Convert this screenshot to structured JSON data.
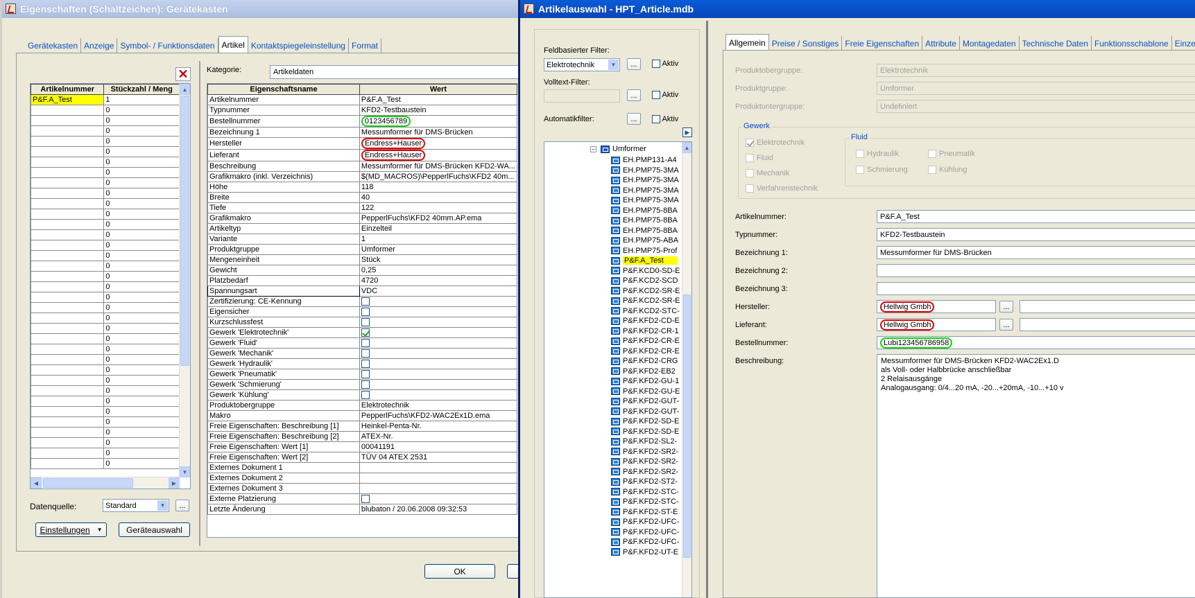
{
  "win1": {
    "title": "Eigenschaften (Schaltzeichen): Gerätekasten",
    "tabs": [
      "Gerätekasten",
      "Anzeige",
      "Symbol- / Funktionsdaten",
      "Artikel",
      "Kontaktspiegeleinstellung",
      "Format"
    ],
    "left_table": {
      "headers": [
        "Artikelnummer",
        "Stückzahl / Meng"
      ],
      "first_row": [
        "P&F.A_Test",
        "1"
      ],
      "zero": "0",
      "last_zero": "0"
    },
    "kategorie_label": "Kategorie:",
    "kategorie_value": "Artikeldaten",
    "prop_headers": [
      "Eigenschaftsname",
      "Wert"
    ],
    "props": [
      [
        "Artikelnummer",
        "P&F.A_Test"
      ],
      [
        "Typnummer",
        "KFD2-Testbaustein"
      ],
      [
        "Bestellnummer",
        "0123456789"
      ],
      [
        "Bezeichnung 1",
        "Messumformer für DMS-Brücken"
      ],
      [
        "Hersteller",
        "Endress+Hauser"
      ],
      [
        "Lieferant",
        "Endress+Hauser"
      ],
      [
        "Beschreibung",
        "Messumformer für DMS-Brücken KFD2-WA..."
      ],
      [
        "Grafikmakro (inkl. Verzeichnis)",
        "$(MD_MACROS)\\PepperlFuchs\\KFD2 40m..."
      ],
      [
        "Höhe",
        "118"
      ],
      [
        "Breite",
        "40"
      ],
      [
        "Tiefe",
        "122"
      ],
      [
        "Grafikmakro",
        "PepperlFuchs\\KFD2 40mm.AP.ema"
      ],
      [
        "Artikeltyp",
        "Einzelteil"
      ],
      [
        "Variante",
        "1"
      ],
      [
        "Produktgruppe",
        "Umformer"
      ],
      [
        "Mengeneinheit",
        "Stück"
      ],
      [
        "Gewicht",
        "0,25"
      ],
      [
        "Platzbedarf",
        "4720"
      ],
      [
        "Spannungsart",
        "VDC"
      ],
      [
        "Zertifizierung: CE-Kennung",
        ""
      ],
      [
        "Eigensicher",
        ""
      ],
      [
        "Kurzschlussfest",
        ""
      ],
      [
        "Gewerk 'Elektrotechnik'",
        ""
      ],
      [
        "Gewerk 'Fluid'",
        ""
      ],
      [
        "Gewerk 'Mechanik'",
        ""
      ],
      [
        "Gewerk 'Hydraulik'",
        ""
      ],
      [
        "Gewerk 'Pneumatik'",
        ""
      ],
      [
        "Gewerk 'Schmierung'",
        ""
      ],
      [
        "Gewerk 'Kühlung'",
        ""
      ],
      [
        "Produktobergruppe",
        "Elektrotechnik"
      ],
      [
        "Makro",
        "PepperlFuchs\\KFD2-WAC2Ex1D.ema"
      ],
      [
        "Freie Eigenschaften: Beschreibung [1]",
        "Heinkel-Penta-Nr."
      ],
      [
        "Freie Eigenschaften: Beschreibung [2]",
        "ATEX-Nr."
      ],
      [
        "Freie Eigenschaften: Wert [1]",
        "00041191"
      ],
      [
        "Freie Eigenschaften: Wert [2]",
        "TÜV 04 ATEX 2531"
      ],
      [
        "Externes Dokument 1",
        ""
      ],
      [
        "Externes Dokument 2",
        ""
      ],
      [
        "Externes Dokument 3",
        ""
      ],
      [
        "Externe Platzierung",
        ""
      ],
      [
        "Letzte Änderung",
        "blubaton / 20.06.2008 09:32:53"
      ]
    ],
    "datenquelle_label": "Datenquelle:",
    "datenquelle_value": "Standard",
    "btn_einstellungen": "Einstellungen",
    "btn_geraeteauswahl": "Geräteauswahl",
    "btn_ok": "OK",
    "dots": "..."
  },
  "win2": {
    "title": "Artikelauswahl - HPT_Article.mdb",
    "feld_filter_label": "Feldbasierter Filter:",
    "feld_filter_value": "Elektrotechnik",
    "volltext_label": "Volltext-Filter:",
    "automatik_label": "Automatikfilter:",
    "aktiv": "Aktiv",
    "dots": "...",
    "tree_root": "Umformer",
    "tree_items": [
      "EH.PMP131-A4",
      "EH.PMP75-3MA",
      "EH.PMP75-3MA",
      "EH.PMP75-3MA",
      "EH.PMP75-3MA",
      "EH.PMP75-8BA",
      "EH.PMP75-8BA",
      "EH.PMP75-8BA",
      "EH.PMP75-ABA",
      "EH.PMP75-Prof",
      "P&F.A_Test",
      "P&F.KCD0-SD-E",
      "P&F.KCD2-SCD",
      "P&F.KCD2-SR-E",
      "P&F.KCD2-SR-E",
      "P&F.KCD2-STC-",
      "P&F.KFD2-CD-E",
      "P&F.KFD2-CR-1",
      "P&F.KFD2-CR-E",
      "P&F.KFD2-CR-E",
      "P&F.KFD2-CRG",
      "P&F.KFD2-EB2",
      "P&F.KFD2-GU-1",
      "P&F.KFD2-GU-E",
      "P&F.KFD2-GUT-",
      "P&F.KFD2-GUT-",
      "P&F.KFD2-SD-E",
      "P&F.KFD2-SD-E",
      "P&F.KFD2-SL2-",
      "P&F.KFD2-SR2-",
      "P&F.KFD2-SR2-",
      "P&F.KFD2-SR2-",
      "P&F.KFD2-ST2-",
      "P&F.KFD2-STC-",
      "P&F.KFD2-STC-",
      "P&F.KFD2-ST-E",
      "P&F.KFD2-UFC-",
      "P&F.KFD2-UFC-",
      "P&F.KFD2-UFC-",
      "P&F.KFD2-UT-E"
    ],
    "tabs": [
      "Allgemein",
      "Preise / Sonstiges",
      "Freie Eigenschaften",
      "Attribute",
      "Montagedaten",
      "Technische Daten",
      "Funktionsschablone",
      "Einzelteildaten"
    ],
    "produktobergruppe_label": "Produktobergruppe:",
    "produktobergruppe_value": "Elektrotechnik",
    "produktgruppe_label": "Produktgruppe:",
    "produktgruppe_value": "Umformer",
    "produktuntergruppe_label": "Produktuntergruppe:",
    "produktuntergruppe_value": "Undefiniert",
    "gewerk_label": "Gewerk",
    "gewerk_items": [
      "Elektrotechnik",
      "Fluid",
      "Mechanik",
      "Verfahrenstechnik"
    ],
    "fluid_label": "Fluid",
    "fluid_items": [
      "Hydraulik",
      "Pneumatik",
      "Schmierung",
      "Kühlung"
    ],
    "artikelnummer_label": "Artikelnummer:",
    "artikelnummer_value": "P&F.A_Test",
    "typnummer_label": "Typnummer:",
    "typnummer_value": "KFD2-Testbaustein",
    "bez1_label": "Bezeichnung 1:",
    "bez1_value": "Messumformer für DMS-Brücken",
    "bez2_label": "Bezeichnung 2:",
    "bez3_label": "Bezeichnung 3:",
    "hersteller_label": "Hersteller:",
    "hersteller_value": "Hellwig Gmbh",
    "lieferant_label": "Lieferant:",
    "lieferant_value": "Hellwig Gmbh",
    "bestellnummer_label": "Bestellnummer:",
    "bestellnummer_value": "Lubi123456786958",
    "beschreibung_label": "Beschreibung:",
    "beschreibung_lines": [
      "Messumformer für DMS-Brücken KFD2-WAC2Ex1.D",
      "als Voll- oder Halbbrücke anschließbar",
      "2 Relaisausgänge",
      "Analogausgang: 0/4...20 mA, -20...+20mA, -10...+10 v"
    ]
  }
}
